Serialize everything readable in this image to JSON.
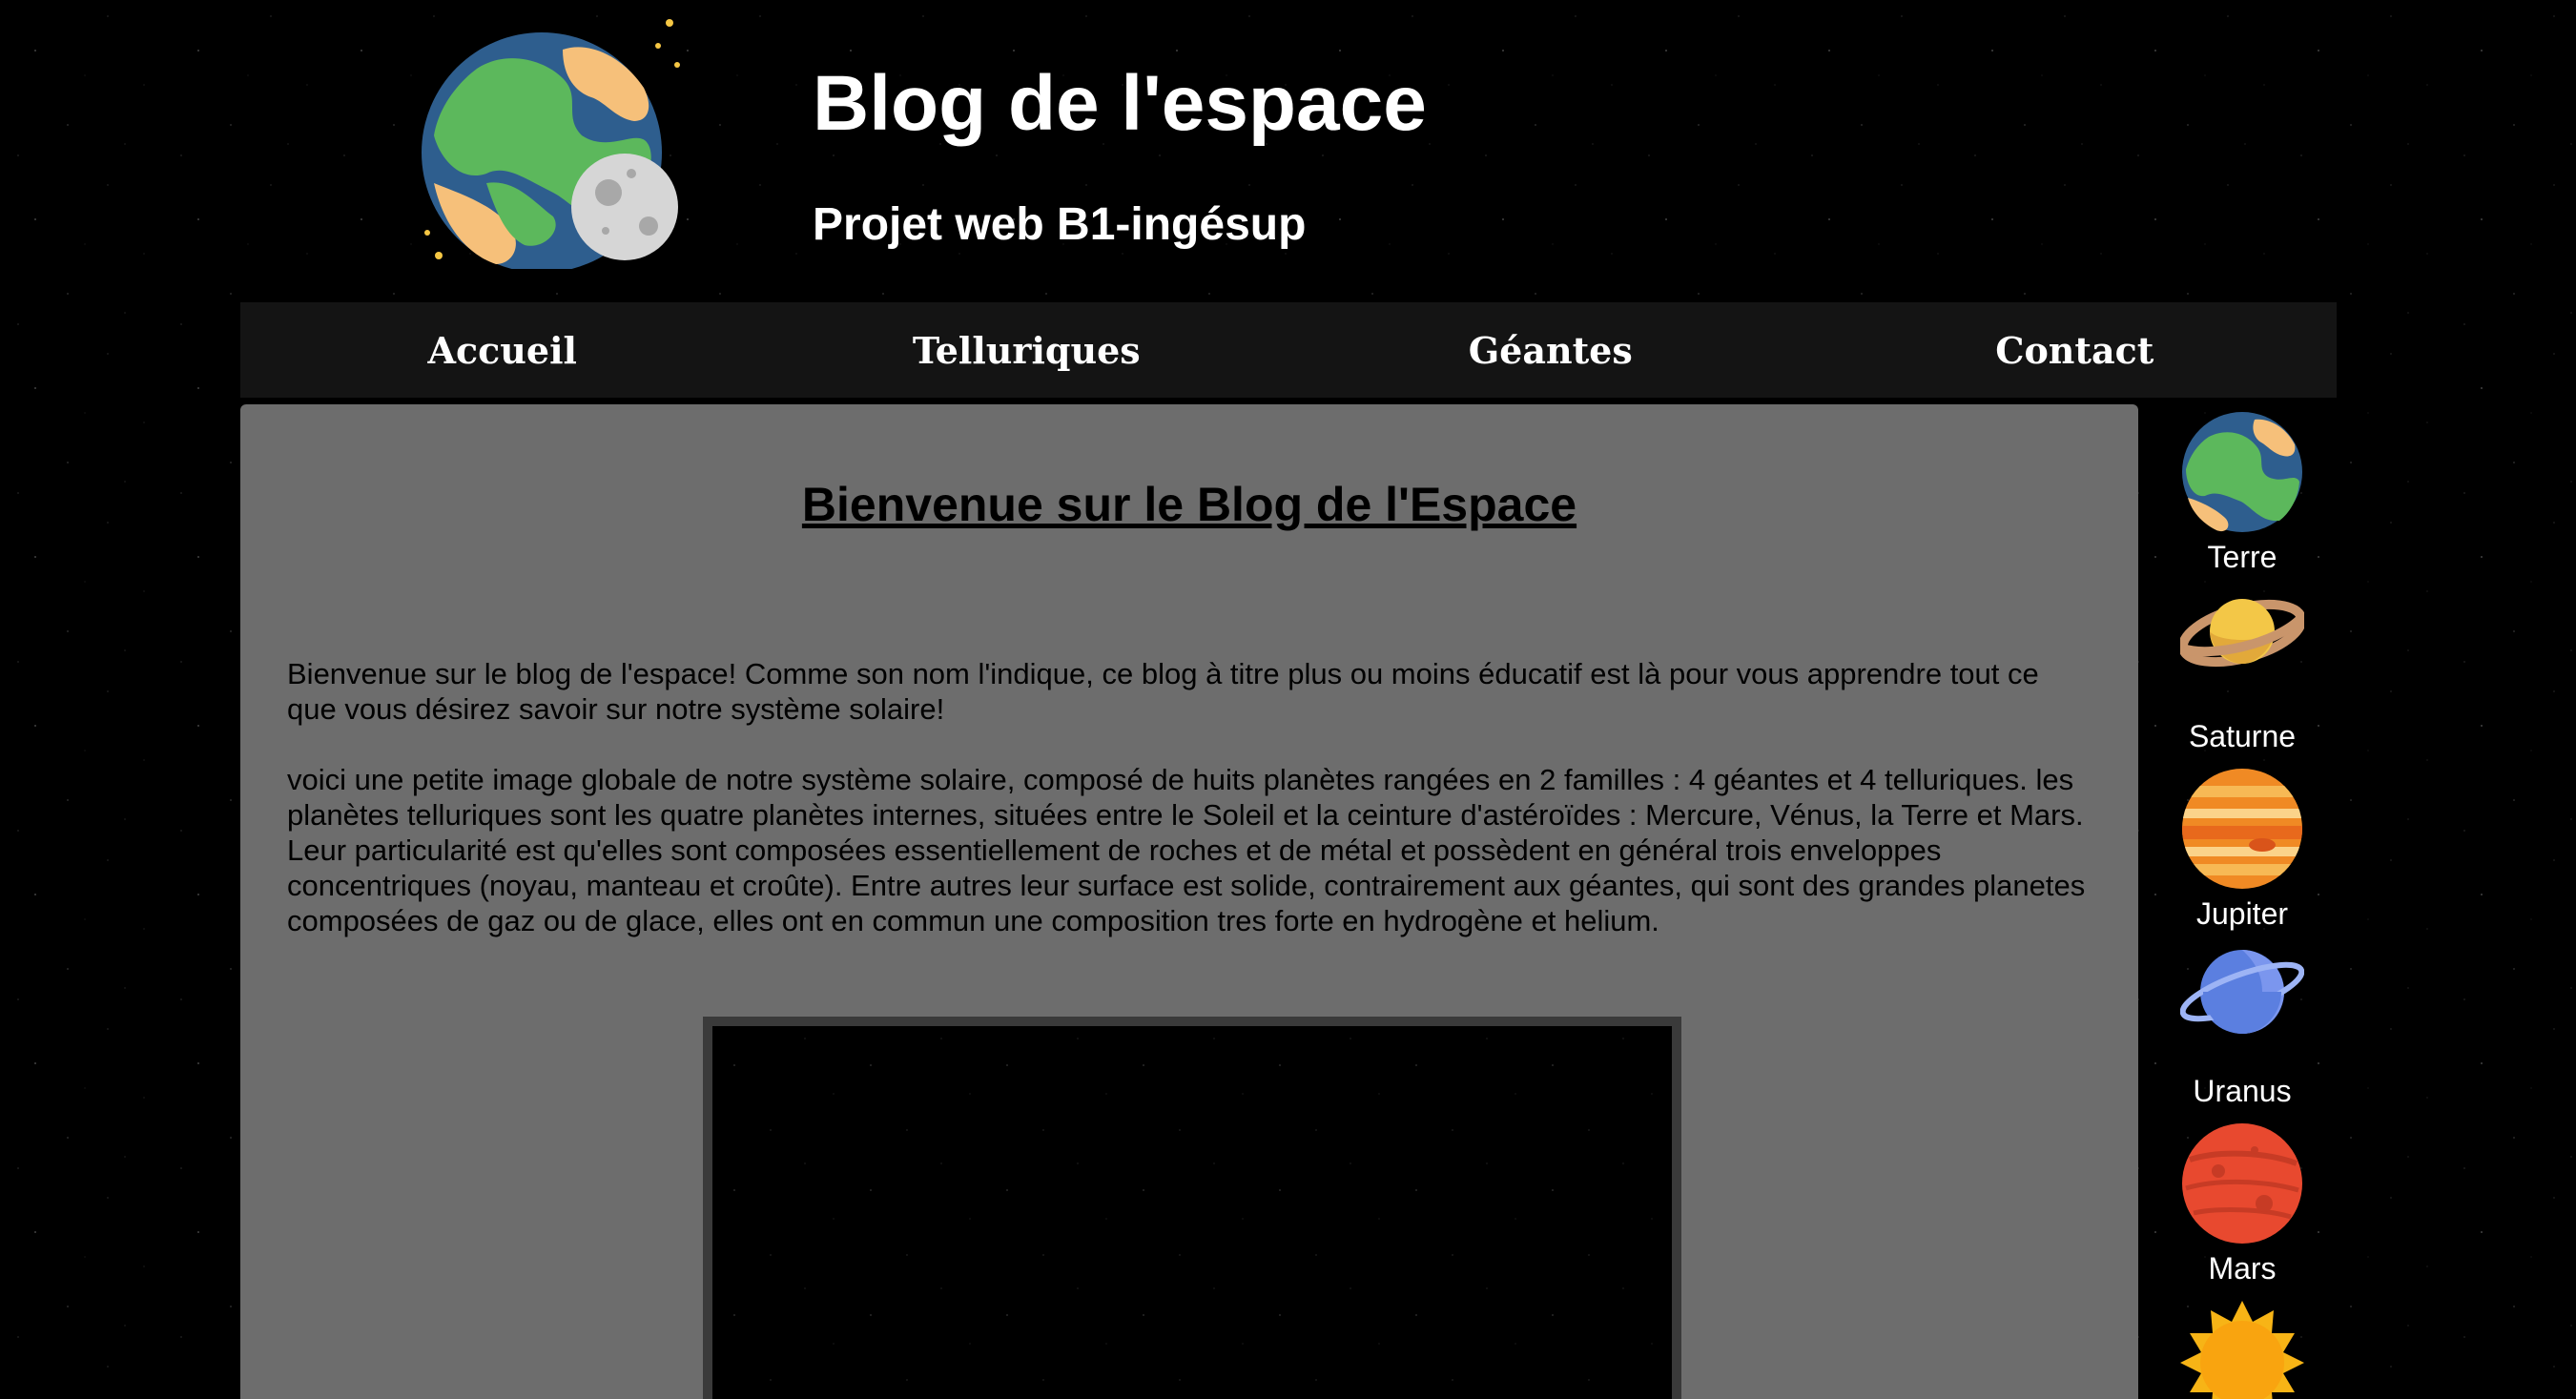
{
  "header": {
    "title": "Blog de l'espace",
    "subtitle": "Projet web B1-ingésup",
    "logo_icon": "earth-moon-icon"
  },
  "nav": {
    "items": [
      {
        "label": "Accueil"
      },
      {
        "label": "Telluriques"
      },
      {
        "label": "Géantes"
      },
      {
        "label": "Contact"
      }
    ]
  },
  "main": {
    "title": "Bienvenue sur le Blog de l'Espace",
    "paragraphs": [
      "Bienvenue sur le blog de l'espace! Comme son nom l'indique, ce blog à titre plus ou moins éducatif est là pour vous apprendre tout ce que vous désirez savoir sur notre système solaire!",
      "voici une petite image globale de notre système solaire, composé de huits planètes rangées en 2 familles : 4 géantes et 4 telluriques. les planètes telluriques sont les quatre planètes internes, situées entre le Soleil et la ceinture d'astéroïdes : Mercure, Vénus, la Terre et Mars. Leur particularité est qu'elles sont composées essentiellement de roches et de métal et possèdent en général trois enveloppes concentriques (noyau, manteau et croûte). Entre autres leur surface est solide, contrairement aux géantes, qui sont des grandes planetes composées de gaz ou de glace, elles ont en commun une composition tres forte en hydrogène et helium."
    ]
  },
  "sidebar": {
    "planets": [
      {
        "label": "Terre",
        "icon": "earth-icon"
      },
      {
        "label": "Saturne",
        "icon": "saturn-icon"
      },
      {
        "label": "Jupiter",
        "icon": "jupiter-icon"
      },
      {
        "label": "Uranus",
        "icon": "uranus-icon"
      },
      {
        "label": "Mars",
        "icon": "mars-icon"
      },
      {
        "label": "",
        "icon": "sun-icon"
      }
    ]
  }
}
